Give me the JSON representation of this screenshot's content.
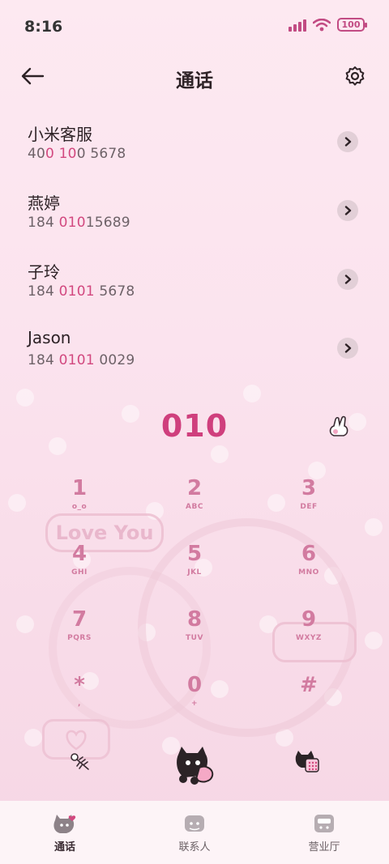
{
  "status_bar": {
    "time": "8:16",
    "battery": "100"
  },
  "header": {
    "title": "通话"
  },
  "calls": [
    {
      "name": "小米客服",
      "num_a": "40",
      "num_hl1": "0 10",
      "num_b": "0 5678",
      "num_hl2": ""
    },
    {
      "name": "燕婷",
      "num_a": "184 ",
      "num_hl1": "010",
      "num_b": "15689",
      "num_hl2": ""
    },
    {
      "name": "子玲",
      "num_a": "184 ",
      "num_hl1": "0101",
      "num_b": " 5678",
      "num_hl2": ""
    },
    {
      "name": "Jason",
      "num_a": "184 ",
      "num_hl1": "0101",
      "num_b": " 0029",
      "num_hl2": ""
    }
  ],
  "decor": {
    "love_text": "Love You"
  },
  "dialer": {
    "input": "010",
    "keys": [
      {
        "digit": "1",
        "letters": "o_o"
      },
      {
        "digit": "2",
        "letters": "ABC"
      },
      {
        "digit": "3",
        "letters": "DEF"
      },
      {
        "digit": "4",
        "letters": "GHI"
      },
      {
        "digit": "5",
        "letters": "JKL"
      },
      {
        "digit": "6",
        "letters": "MNO"
      },
      {
        "digit": "7",
        "letters": "PQRS"
      },
      {
        "digit": "8",
        "letters": "TUV"
      },
      {
        "digit": "9",
        "letters": "WXYZ"
      },
      {
        "digit": "*",
        "letters": ","
      },
      {
        "digit": "0",
        "letters": "+"
      },
      {
        "digit": "#",
        "letters": ""
      }
    ]
  },
  "bottom_nav": {
    "tabs": [
      {
        "label": "通话",
        "icon": "cat-phone-icon"
      },
      {
        "label": "联系人",
        "icon": "cat-contacts-icon"
      },
      {
        "label": "营业厅",
        "icon": "cat-store-icon"
      }
    ]
  },
  "colors": {
    "accent": "#cf3f7d",
    "key": "#d27ba0",
    "background": "#fbe3ee"
  }
}
